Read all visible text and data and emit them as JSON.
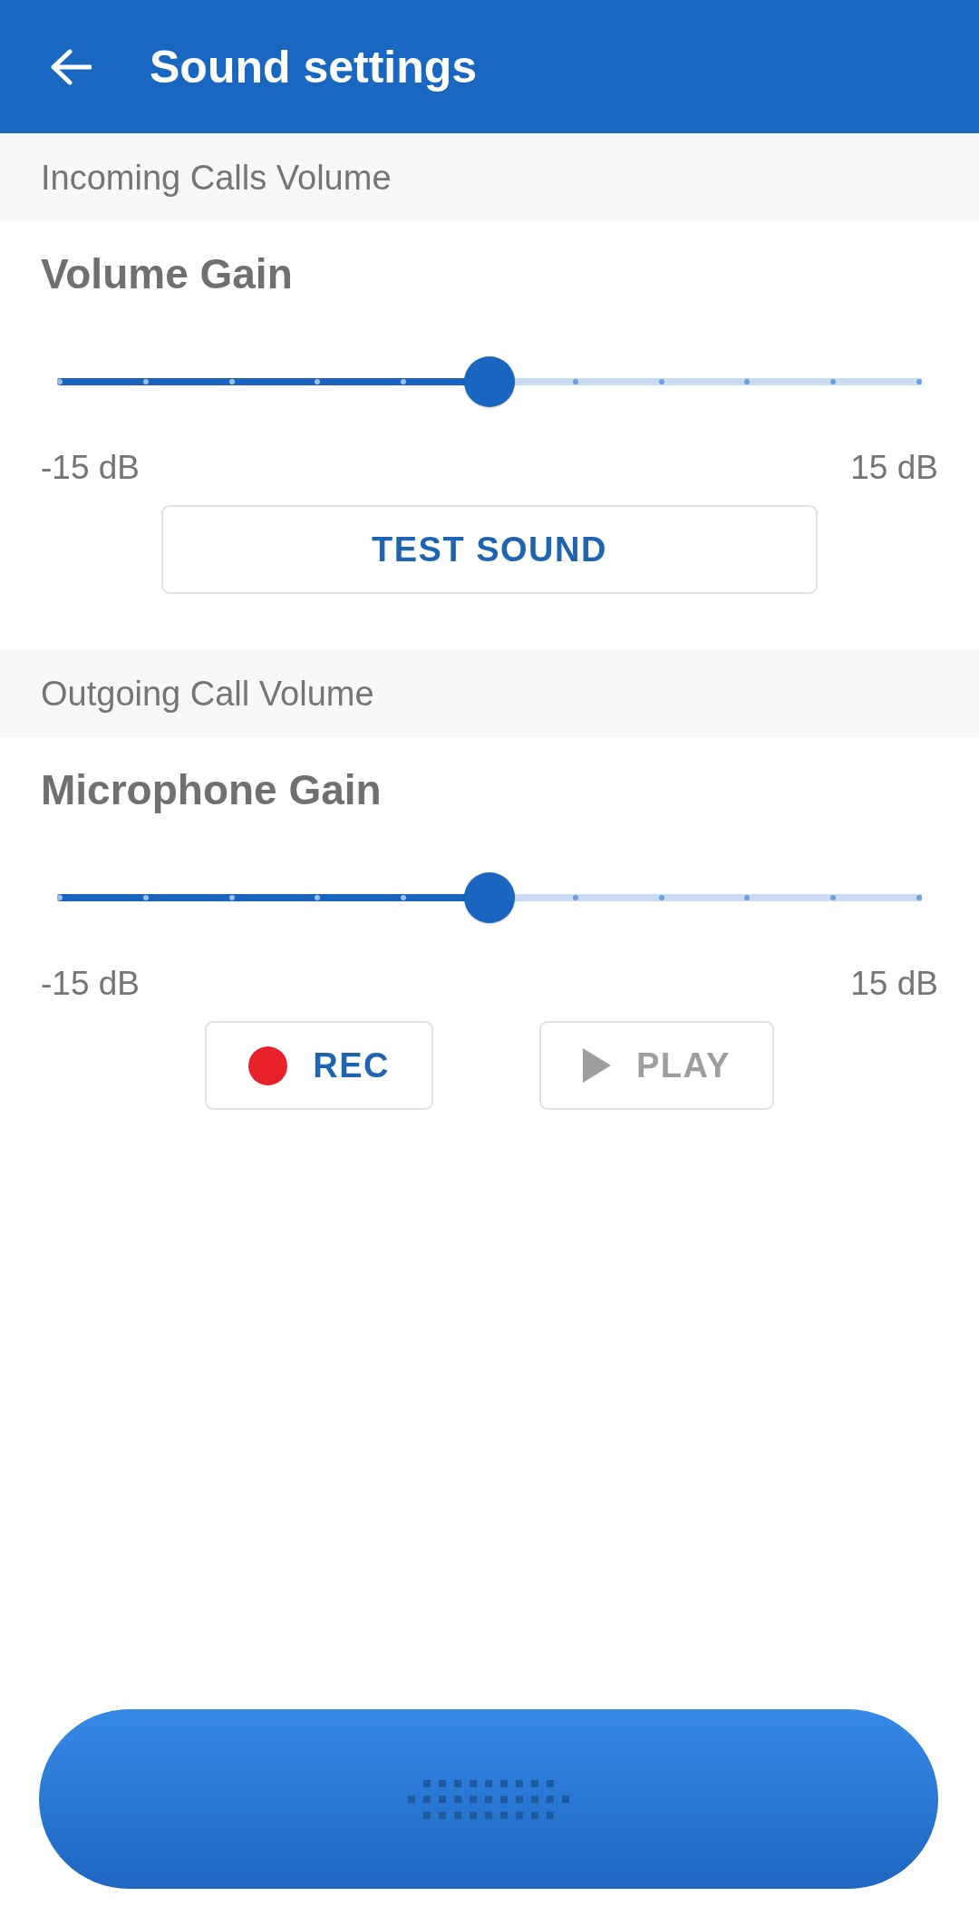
{
  "app_bar": {
    "title": "Sound settings"
  },
  "sections": [
    {
      "header": "Incoming Calls Volume",
      "title": "Volume Gain",
      "slider": {
        "level": 0.5,
        "min_label": "-15 dB",
        "max_label": "15 dB"
      },
      "buttons": [
        {
          "kind": "text",
          "label": "TEST SOUND",
          "disabled": false
        }
      ]
    },
    {
      "header": "Outgoing Call Volume",
      "title": "Microphone Gain",
      "slider": {
        "level": 0.5,
        "min_label": "-15 dB",
        "max_label": "15 dB"
      },
      "buttons": [
        {
          "kind": "record",
          "label": "REC",
          "disabled": false
        },
        {
          "kind": "play",
          "label": "PLAY",
          "disabled": true
        }
      ]
    }
  ]
}
